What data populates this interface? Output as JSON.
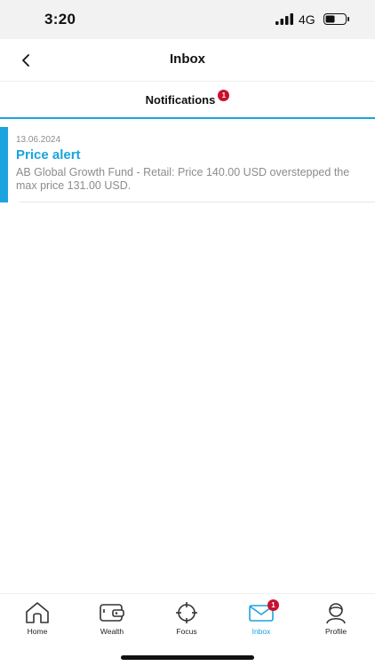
{
  "status_bar": {
    "time": "3:20",
    "network": "4G",
    "icons": [
      "signal-icon",
      "battery-icon"
    ]
  },
  "header": {
    "title": "Inbox",
    "back_icon": "chevron-left-icon"
  },
  "tabs": [
    {
      "label": "Notifications",
      "badge": "1",
      "active": true
    }
  ],
  "notifications": [
    {
      "date": "13.06.2024",
      "title": "Price alert",
      "body": "AB Global Growth Fund - Retail: Price 140.00 USD overstepped the max price 131.00 USD.",
      "unread": true
    }
  ],
  "bottom_nav": {
    "items": [
      {
        "label": "Home",
        "icon": "home-icon",
        "active": false
      },
      {
        "label": "Wealth",
        "icon": "wallet-icon",
        "active": false
      },
      {
        "label": "Focus",
        "icon": "crosshair-icon",
        "active": false
      },
      {
        "label": "Inbox",
        "icon": "envelope-icon",
        "active": true,
        "badge": "1"
      },
      {
        "label": "Profile",
        "icon": "profile-icon",
        "active": false
      }
    ]
  },
  "colors": {
    "accent": "#1aa3de",
    "badge": "#c8102e",
    "muted_text": "#8c8c8c"
  }
}
